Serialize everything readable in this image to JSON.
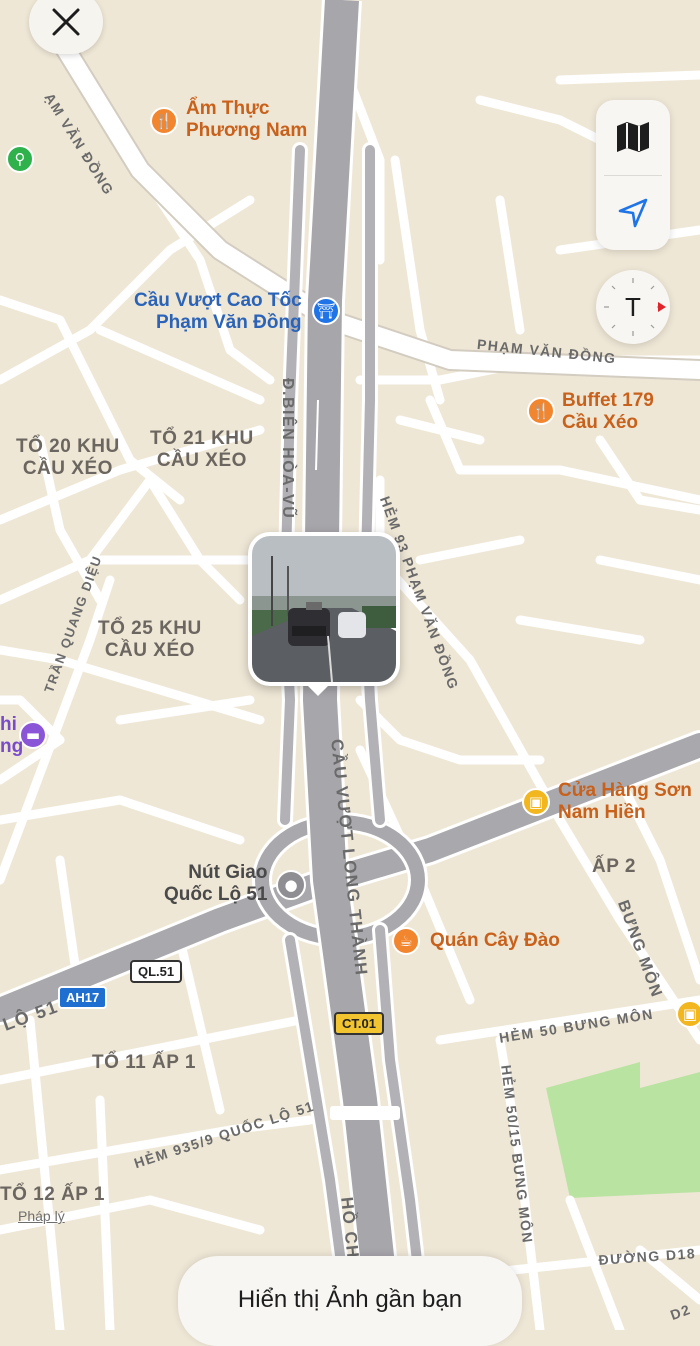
{
  "pois": {
    "am_thuc": {
      "line1": "Ẩm Thực",
      "line2": "Phương Nam"
    },
    "cau_vuot_cao_toc": {
      "line1": "Cầu Vượt Cao Tốc",
      "line2": "Phạm Văn Đồng"
    },
    "buffet": {
      "line1": "Buffet 179",
      "line2": "Cầu Xéo"
    },
    "cua_hang_son": {
      "line1": "Cửa Hàng Sơn",
      "line2": "Nam Hiền"
    },
    "nut_giao": {
      "line1": "Nút Giao",
      "line2": "Quốc Lộ 51"
    },
    "quan_cay_dao": {
      "line1": "Quán Cây Đào"
    },
    "hotel_partial": {
      "line1": "hi",
      "line2": "ng"
    }
  },
  "areas": {
    "to20": {
      "line1": "TỔ 20 KHU",
      "line2": "CẦU XÉO"
    },
    "to21": {
      "line1": "TỔ 21 KHU",
      "line2": "CẦU XÉO"
    },
    "to25": {
      "line1": "TỔ 25 KHU",
      "line2": "CẦU XÉO"
    },
    "ap2": "ẤP 2",
    "to11": "TỔ 11 ẤP 1",
    "to12": "TỔ 12 ẤP 1"
  },
  "streets": {
    "pham_van_dong_top": "ẠM VĂN ĐỒNG",
    "pham_van_dong": "PHẠM VĂN ĐỒNG",
    "dien_bien": "Đ.BIÊN HÒA-VŨ",
    "hem_pvd": "HẺM 93 PHẠM VĂN ĐỒNG",
    "tran_quang_dieu": "TRẦN QUANG DIỆU",
    "cau_vuot_long_thanh": "CẦU VƯỢT LONG THÀNH",
    "bung_mon": "BƯNG MÔN",
    "hem50": "HẺM 50 BƯNG MÔN",
    "hem50_15": "HẺM 50/15 BƯNG MÔN",
    "hem935": "HẺM 935/9 QUỐC LỘ 51",
    "duong_d18": "ĐƯỜNG D18",
    "ql51_road": "LỘ 51",
    "hoch": "HỒ CH",
    "d2": "D2"
  },
  "shields": {
    "ql51": "QL.51",
    "ah17": "AH17",
    "ct01": "CT.01"
  },
  "controls": {
    "map_icon": "map-icon",
    "location_icon": "location-arrow-icon",
    "compass_letter": "T"
  },
  "bottom_bar": {
    "label": "Hiển thị Ảnh gần bạn"
  },
  "legal": "Pháp lý",
  "colors": {
    "land": "#efe7d6",
    "road": "#ffffff",
    "highway": "#a9a8ad",
    "park": "#b9e3a1",
    "poi_orange": "#f2862f",
    "poi_blue": "#1f74e8",
    "poi_purple": "#8b55d8",
    "poi_yellow": "#f2b61f",
    "accent": "#1f74e8"
  }
}
